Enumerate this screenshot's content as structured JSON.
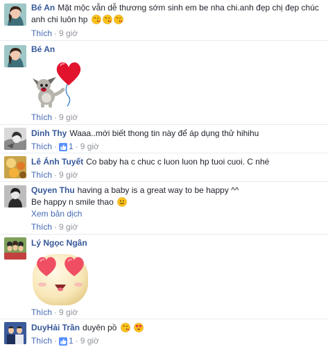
{
  "actions": {
    "like": "Thích",
    "sep": "·",
    "translate": "Xem bản dịch"
  },
  "comments": [
    {
      "author": "Bé An",
      "lines": [
        "Mặt mộc vẫn dễ thương sớm sinh em be nha chi.anh đẹp chị đẹp chúc",
        "anh chi luôn hp"
      ],
      "time": "9 giờ"
    },
    {
      "author": "Bé An",
      "sticker": "dog-with-heart-balloon",
      "time": "9 giờ"
    },
    {
      "author": "Dinh Thy",
      "text": "Waaa..mới biết thong tin này để áp dụng thử hihihu",
      "likes": "1",
      "time": "9 giờ"
    },
    {
      "author": "Lê Ánh Tuyết",
      "text": "Co baby ha c chuc c luon luon hp tuoi cuoi. C nhé",
      "time": "9 giờ"
    },
    {
      "author": "Quyen Thu",
      "text": "having a baby is a great way to be happy ^^",
      "line2": "Be happy n smile thao",
      "time": "9 giờ"
    },
    {
      "author": "Lý Ngọc Ngân",
      "sticker": "heart-eyes-emoji",
      "time": "9 giờ"
    },
    {
      "author": "DuyHải Trần",
      "text": "duyên pồ",
      "likes": "1",
      "time": "9 giờ"
    }
  ],
  "icons": {
    "kiss": "kiss-emoji-icon",
    "smile": "smile-emoji-icon",
    "hearteyes": "heart-eyes-emoji-icon",
    "like": "like-thumb-icon"
  },
  "colors": {
    "author": "#365899",
    "link": "#4267b2",
    "meta": "#90949c"
  }
}
